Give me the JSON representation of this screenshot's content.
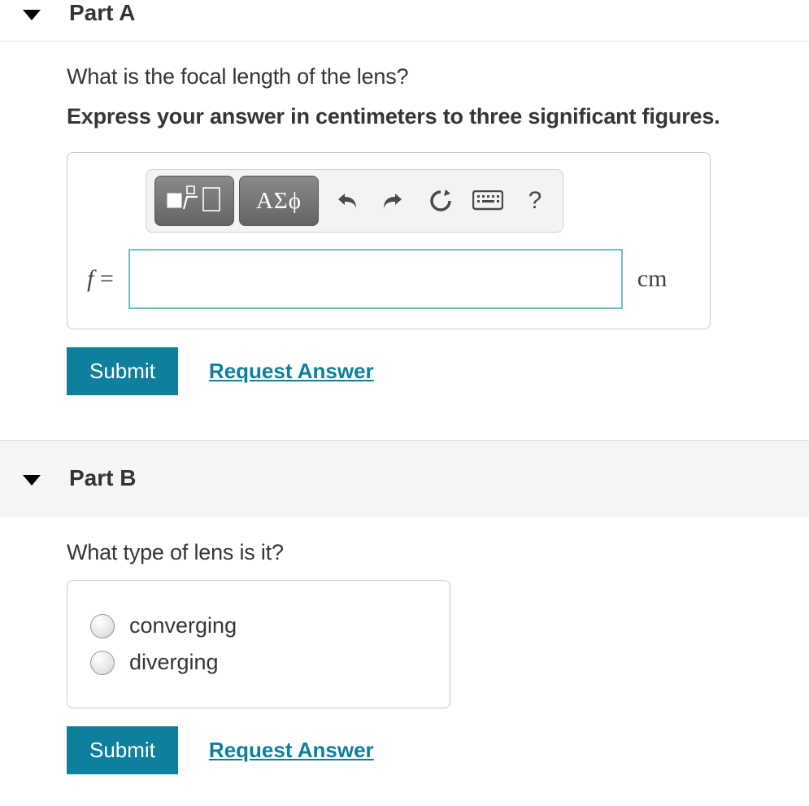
{
  "partA": {
    "title": "Part A",
    "question": "What is the focal length of the lens?",
    "instruction": "Express your answer in centimeters to three significant figures.",
    "toolbar": {
      "greek_label": "ΑΣϕ",
      "help_label": "?"
    },
    "variable": "f",
    "equals": " = ",
    "input_value": "",
    "unit": "cm",
    "submit": "Submit",
    "request": "Request Answer"
  },
  "partB": {
    "title": "Part B",
    "question": "What type of lens is it?",
    "options": [
      "converging",
      "diverging"
    ],
    "submit": "Submit",
    "request": "Request Answer"
  }
}
